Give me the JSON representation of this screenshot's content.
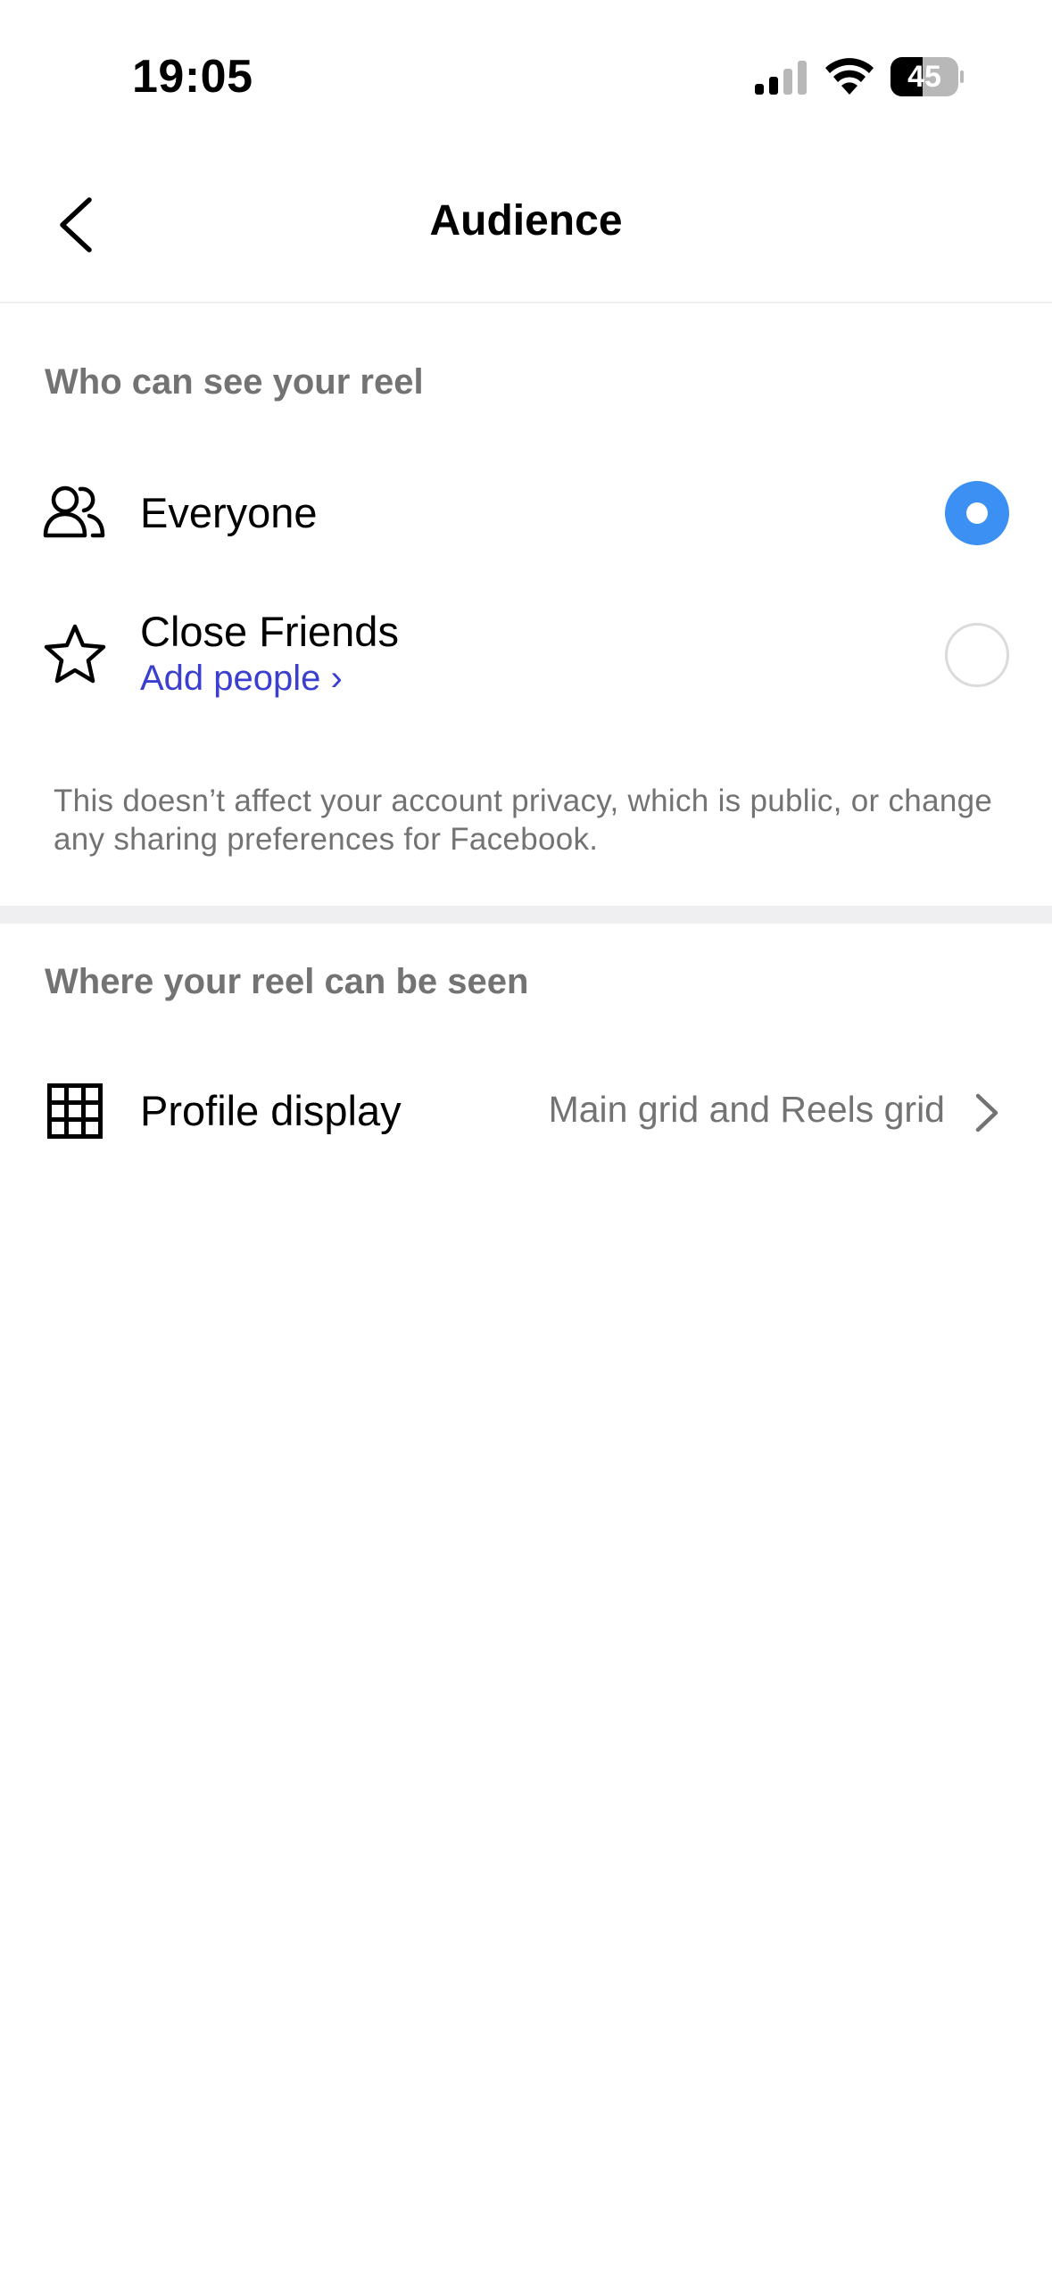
{
  "status_bar": {
    "time": "19:05",
    "battery": "45",
    "icons": [
      "signal-icon",
      "wifi-icon",
      "battery-icon"
    ]
  },
  "header": {
    "title": "Audience",
    "back_icon": "chevron-left-icon"
  },
  "audience_section": {
    "title": "Who can see your reel",
    "options": [
      {
        "label": "Everyone",
        "icon": "people-icon",
        "selected": true
      },
      {
        "label": "Close Friends",
        "sub_label": "Add people ›",
        "icon": "star-icon",
        "selected": false
      }
    ],
    "note": "This doesn’t affect your account privacy, which is public, or change any sharing preferences for Facebook."
  },
  "visibility_section": {
    "title": "Where your reel can be seen",
    "items": [
      {
        "label": "Profile display",
        "value": "Main grid and Reels grid",
        "icon": "grid-icon"
      }
    ]
  },
  "colors": {
    "accent": "#3c8ff3",
    "link": "#3a3fcf",
    "secondary_text": "#737373"
  }
}
